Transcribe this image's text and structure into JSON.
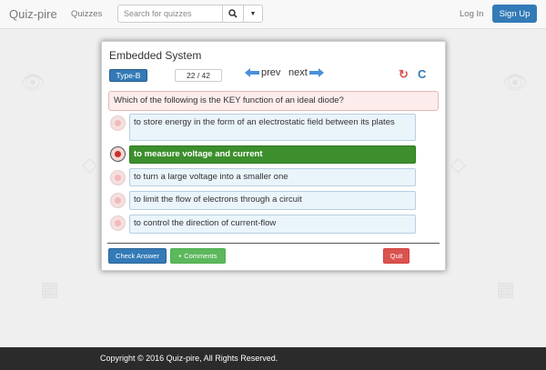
{
  "navbar": {
    "brand": "Quiz-pire",
    "quizzes_link": "Quizzes",
    "search_placeholder": "Search for quizzes",
    "login": "Log In",
    "signup": "Sign Up"
  },
  "quiz": {
    "title": "Embedded System",
    "type_label": "Type-B",
    "question_counter": "22 / 42",
    "prev_label": "prev",
    "next_label": "next",
    "question": "Which of the following is the KEY function of an ideal diode?",
    "options": [
      {
        "text": "to store energy in the form of an electrostatic field between its plates",
        "selected": false
      },
      {
        "text": "to measure voltage and current",
        "selected": true
      },
      {
        "text": "to turn a large voltage into a smaller one",
        "selected": false
      },
      {
        "text": "to limit the flow of electrons through a circuit",
        "selected": false
      },
      {
        "text": "to control the direction of current-flow",
        "selected": false
      }
    ],
    "check_answer": "Check Answer",
    "comments": "Comments",
    "quit": "Quit"
  },
  "footer": {
    "copyright": "Copyright © 2016 Quiz-pire, All Rights Reserved."
  },
  "colors": {
    "primary": "#337ab7",
    "selected_option": "#3c8f2c",
    "danger": "#d9534f",
    "success": "#5cb85c"
  }
}
